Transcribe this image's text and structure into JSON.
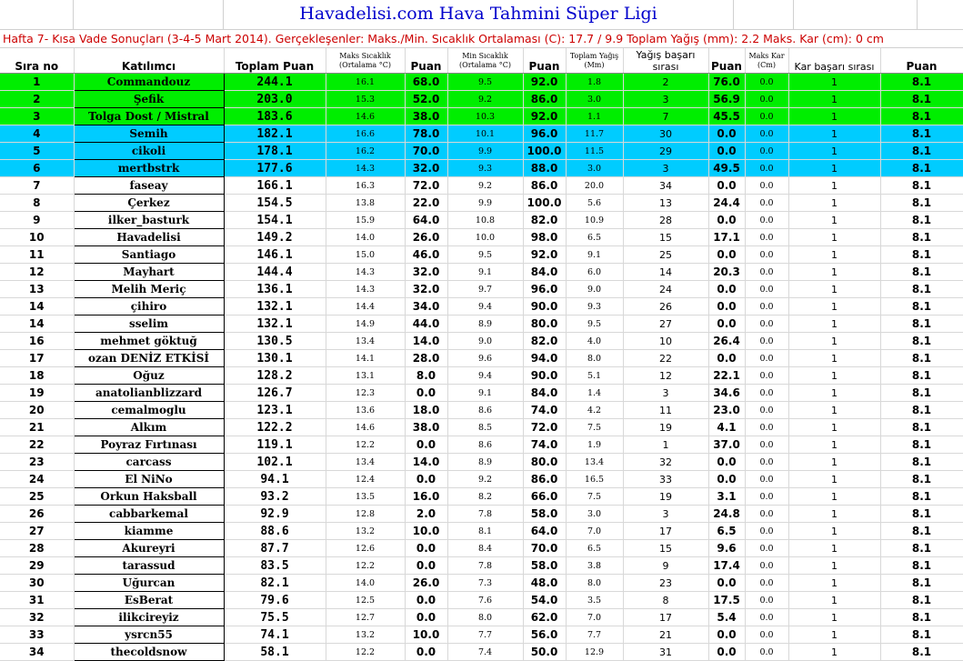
{
  "title": "Havadelisi.com Hava Tahmini Süper Ligi",
  "subtitle": "Hafta 7- Kısa Vade Sonuçları (3-4-5 Mart 2014). Gerçekleşenler: Maks./Min. Sıcaklık Ortalaması (C): 17.7 / 9.9 Toplam Yağış (mm): 2.2 Maks. Kar (cm): 0 cm",
  "headers": {
    "rank": "Sıra no",
    "participant": "Katılımcı",
    "total": "Toplam Puan",
    "max_temp_line1": "Maks Sıcaklık",
    "max_temp_line2": "(Ortalama °C)",
    "points1": "Puan",
    "min_temp_line1": "Min Sıcaklık",
    "min_temp_line2": "(Ortalama °C)",
    "points2": "Puan",
    "rain_line1": "Toplam Yağış",
    "rain_line2": "(Mm)",
    "rain_rank": "Yağış başarı sırası",
    "points3": "Puan",
    "snow_line1": "Maks Kar",
    "snow_line2": "(Cm)",
    "snow_rank": "Kar başarı sırası",
    "points4": "Puan"
  },
  "highlight_colors": {
    "top3": "#00ee00",
    "next3": "#00ccff"
  },
  "rows": [
    {
      "rank": "1",
      "name": "Commandouz",
      "total": "244.1",
      "max": "16.1",
      "p1": "68.0",
      "min": "9.5",
      "p2": "92.0",
      "rain": "1.8",
      "rrank": "2",
      "p3": "76.0",
      "snow": "0.0",
      "srank": "1",
      "p4": "8.1"
    },
    {
      "rank": "2",
      "name": "Şefik",
      "total": "203.0",
      "max": "15.3",
      "p1": "52.0",
      "min": "9.2",
      "p2": "86.0",
      "rain": "3.0",
      "rrank": "3",
      "p3": "56.9",
      "snow": "0.0",
      "srank": "1",
      "p4": "8.1"
    },
    {
      "rank": "3",
      "name": "Tolga Dost / Mistral",
      "total": "183.6",
      "max": "14.6",
      "p1": "38.0",
      "min": "10.3",
      "p2": "92.0",
      "rain": "1.1",
      "rrank": "7",
      "p3": "45.5",
      "snow": "0.0",
      "srank": "1",
      "p4": "8.1"
    },
    {
      "rank": "4",
      "name": "Semih",
      "total": "182.1",
      "max": "16.6",
      "p1": "78.0",
      "min": "10.1",
      "p2": "96.0",
      "rain": "11.7",
      "rrank": "30",
      "p3": "0.0",
      "snow": "0.0",
      "srank": "1",
      "p4": "8.1"
    },
    {
      "rank": "5",
      "name": "cikoli",
      "total": "178.1",
      "max": "16.2",
      "p1": "70.0",
      "min": "9.9",
      "p2": "100.0",
      "rain": "11.5",
      "rrank": "29",
      "p3": "0.0",
      "snow": "0.0",
      "srank": "1",
      "p4": "8.1"
    },
    {
      "rank": "6",
      "name": "mertbstrk",
      "total": "177.6",
      "max": "14.3",
      "p1": "32.0",
      "min": "9.3",
      "p2": "88.0",
      "rain": "3.0",
      "rrank": "3",
      "p3": "49.5",
      "snow": "0.0",
      "srank": "1",
      "p4": "8.1"
    },
    {
      "rank": "7",
      "name": "faseay",
      "total": "166.1",
      "max": "16.3",
      "p1": "72.0",
      "min": "9.2",
      "p2": "86.0",
      "rain": "20.0",
      "rrank": "34",
      "p3": "0.0",
      "snow": "0.0",
      "srank": "1",
      "p4": "8.1"
    },
    {
      "rank": "8",
      "name": "Çerkez",
      "total": "154.5",
      "max": "13.8",
      "p1": "22.0",
      "min": "9.9",
      "p2": "100.0",
      "rain": "5.6",
      "rrank": "13",
      "p3": "24.4",
      "snow": "0.0",
      "srank": "1",
      "p4": "8.1"
    },
    {
      "rank": "9",
      "name": "ilker_basturk",
      "total": "154.1",
      "max": "15.9",
      "p1": "64.0",
      "min": "10.8",
      "p2": "82.0",
      "rain": "10.9",
      "rrank": "28",
      "p3": "0.0",
      "snow": "0.0",
      "srank": "1",
      "p4": "8.1"
    },
    {
      "rank": "10",
      "name": "Havadelisi",
      "total": "149.2",
      "max": "14.0",
      "p1": "26.0",
      "min": "10.0",
      "p2": "98.0",
      "rain": "6.5",
      "rrank": "15",
      "p3": "17.1",
      "snow": "0.0",
      "srank": "1",
      "p4": "8.1"
    },
    {
      "rank": "11",
      "name": "Santiago",
      "total": "146.1",
      "max": "15.0",
      "p1": "46.0",
      "min": "9.5",
      "p2": "92.0",
      "rain": "9.1",
      "rrank": "25",
      "p3": "0.0",
      "snow": "0.0",
      "srank": "1",
      "p4": "8.1"
    },
    {
      "rank": "12",
      "name": "Mayhart",
      "total": "144.4",
      "max": "14.3",
      "p1": "32.0",
      "min": "9.1",
      "p2": "84.0",
      "rain": "6.0",
      "rrank": "14",
      "p3": "20.3",
      "snow": "0.0",
      "srank": "1",
      "p4": "8.1"
    },
    {
      "rank": "13",
      "name": "Melih Meriç",
      "total": "136.1",
      "max": "14.3",
      "p1": "32.0",
      "min": "9.7",
      "p2": "96.0",
      "rain": "9.0",
      "rrank": "24",
      "p3": "0.0",
      "snow": "0.0",
      "srank": "1",
      "p4": "8.1"
    },
    {
      "rank": "14",
      "name": "çihiro",
      "total": "132.1",
      "max": "14.4",
      "p1": "34.0",
      "min": "9.4",
      "p2": "90.0",
      "rain": "9.3",
      "rrank": "26",
      "p3": "0.0",
      "snow": "0.0",
      "srank": "1",
      "p4": "8.1"
    },
    {
      "rank": "14",
      "name": "sselim",
      "total": "132.1",
      "max": "14.9",
      "p1": "44.0",
      "min": "8.9",
      "p2": "80.0",
      "rain": "9.5",
      "rrank": "27",
      "p3": "0.0",
      "snow": "0.0",
      "srank": "1",
      "p4": "8.1"
    },
    {
      "rank": "16",
      "name": "mehmet göktuğ",
      "total": "130.5",
      "max": "13.4",
      "p1": "14.0",
      "min": "9.0",
      "p2": "82.0",
      "rain": "4.0",
      "rrank": "10",
      "p3": "26.4",
      "snow": "0.0",
      "srank": "1",
      "p4": "8.1"
    },
    {
      "rank": "17",
      "name": "ozan DENİZ ETKİSİ",
      "total": "130.1",
      "max": "14.1",
      "p1": "28.0",
      "min": "9.6",
      "p2": "94.0",
      "rain": "8.0",
      "rrank": "22",
      "p3": "0.0",
      "snow": "0.0",
      "srank": "1",
      "p4": "8.1"
    },
    {
      "rank": "18",
      "name": "Oğuz",
      "total": "128.2",
      "max": "13.1",
      "p1": "8.0",
      "min": "9.4",
      "p2": "90.0",
      "rain": "5.1",
      "rrank": "12",
      "p3": "22.1",
      "snow": "0.0",
      "srank": "1",
      "p4": "8.1"
    },
    {
      "rank": "19",
      "name": "anatolianblizzard",
      "total": "126.7",
      "max": "12.3",
      "p1": "0.0",
      "min": "9.1",
      "p2": "84.0",
      "rain": "1.4",
      "rrank": "3",
      "p3": "34.6",
      "snow": "0.0",
      "srank": "1",
      "p4": "8.1"
    },
    {
      "rank": "20",
      "name": "cemalmoglu",
      "total": "123.1",
      "max": "13.6",
      "p1": "18.0",
      "min": "8.6",
      "p2": "74.0",
      "rain": "4.2",
      "rrank": "11",
      "p3": "23.0",
      "snow": "0.0",
      "srank": "1",
      "p4": "8.1"
    },
    {
      "rank": "21",
      "name": "Alkım",
      "total": "122.2",
      "max": "14.6",
      "p1": "38.0",
      "min": "8.5",
      "p2": "72.0",
      "rain": "7.5",
      "rrank": "19",
      "p3": "4.1",
      "snow": "0.0",
      "srank": "1",
      "p4": "8.1"
    },
    {
      "rank": "22",
      "name": "Poyraz Fırtınası",
      "total": "119.1",
      "max": "12.2",
      "p1": "0.0",
      "min": "8.6",
      "p2": "74.0",
      "rain": "1.9",
      "rrank": "1",
      "p3": "37.0",
      "snow": "0.0",
      "srank": "1",
      "p4": "8.1"
    },
    {
      "rank": "23",
      "name": "carcass",
      "total": "102.1",
      "max": "13.4",
      "p1": "14.0",
      "min": "8.9",
      "p2": "80.0",
      "rain": "13.4",
      "rrank": "32",
      "p3": "0.0",
      "snow": "0.0",
      "srank": "1",
      "p4": "8.1"
    },
    {
      "rank": "24",
      "name": "El NiNo",
      "total": "94.1",
      "max": "12.4",
      "p1": "0.0",
      "min": "9.2",
      "p2": "86.0",
      "rain": "16.5",
      "rrank": "33",
      "p3": "0.0",
      "snow": "0.0",
      "srank": "1",
      "p4": "8.1"
    },
    {
      "rank": "25",
      "name": "Orkun Haksball",
      "total": "93.2",
      "max": "13.5",
      "p1": "16.0",
      "min": "8.2",
      "p2": "66.0",
      "rain": "7.5",
      "rrank": "19",
      "p3": "3.1",
      "snow": "0.0",
      "srank": "1",
      "p4": "8.1"
    },
    {
      "rank": "26",
      "name": "cabbarkemal",
      "total": "92.9",
      "max": "12.8",
      "p1": "2.0",
      "min": "7.8",
      "p2": "58.0",
      "rain": "3.0",
      "rrank": "3",
      "p3": "24.8",
      "snow": "0.0",
      "srank": "1",
      "p4": "8.1"
    },
    {
      "rank": "27",
      "name": "kiamme",
      "total": "88.6",
      "max": "13.2",
      "p1": "10.0",
      "min": "8.1",
      "p2": "64.0",
      "rain": "7.0",
      "rrank": "17",
      "p3": "6.5",
      "snow": "0.0",
      "srank": "1",
      "p4": "8.1"
    },
    {
      "rank": "28",
      "name": "Akureyri",
      "total": "87.7",
      "max": "12.6",
      "p1": "0.0",
      "min": "8.4",
      "p2": "70.0",
      "rain": "6.5",
      "rrank": "15",
      "p3": "9.6",
      "snow": "0.0",
      "srank": "1",
      "p4": "8.1"
    },
    {
      "rank": "29",
      "name": "tarassud",
      "total": "83.5",
      "max": "12.2",
      "p1": "0.0",
      "min": "7.8",
      "p2": "58.0",
      "rain": "3.8",
      "rrank": "9",
      "p3": "17.4",
      "snow": "0.0",
      "srank": "1",
      "p4": "8.1"
    },
    {
      "rank": "30",
      "name": "Uğurcan",
      "total": "82.1",
      "max": "14.0",
      "p1": "26.0",
      "min": "7.3",
      "p2": "48.0",
      "rain": "8.0",
      "rrank": "23",
      "p3": "0.0",
      "snow": "0.0",
      "srank": "1",
      "p4": "8.1"
    },
    {
      "rank": "31",
      "name": "EsBerat",
      "total": "79.6",
      "max": "12.5",
      "p1": "0.0",
      "min": "7.6",
      "p2": "54.0",
      "rain": "3.5",
      "rrank": "8",
      "p3": "17.5",
      "snow": "0.0",
      "srank": "1",
      "p4": "8.1"
    },
    {
      "rank": "32",
      "name": "ilikcireyiz",
      "total": "75.5",
      "max": "12.7",
      "p1": "0.0",
      "min": "8.0",
      "p2": "62.0",
      "rain": "7.0",
      "rrank": "17",
      "p3": "5.4",
      "snow": "0.0",
      "srank": "1",
      "p4": "8.1"
    },
    {
      "rank": "33",
      "name": "ysrcn55",
      "total": "74.1",
      "max": "13.2",
      "p1": "10.0",
      "min": "7.7",
      "p2": "56.0",
      "rain": "7.7",
      "rrank": "21",
      "p3": "0.0",
      "snow": "0.0",
      "srank": "1",
      "p4": "8.1"
    },
    {
      "rank": "34",
      "name": "thecoldsnow",
      "total": "58.1",
      "max": "12.2",
      "p1": "0.0",
      "min": "7.4",
      "p2": "50.0",
      "rain": "12.9",
      "rrank": "31",
      "p3": "0.0",
      "snow": "0.0",
      "srank": "1",
      "p4": "8.1"
    }
  ]
}
